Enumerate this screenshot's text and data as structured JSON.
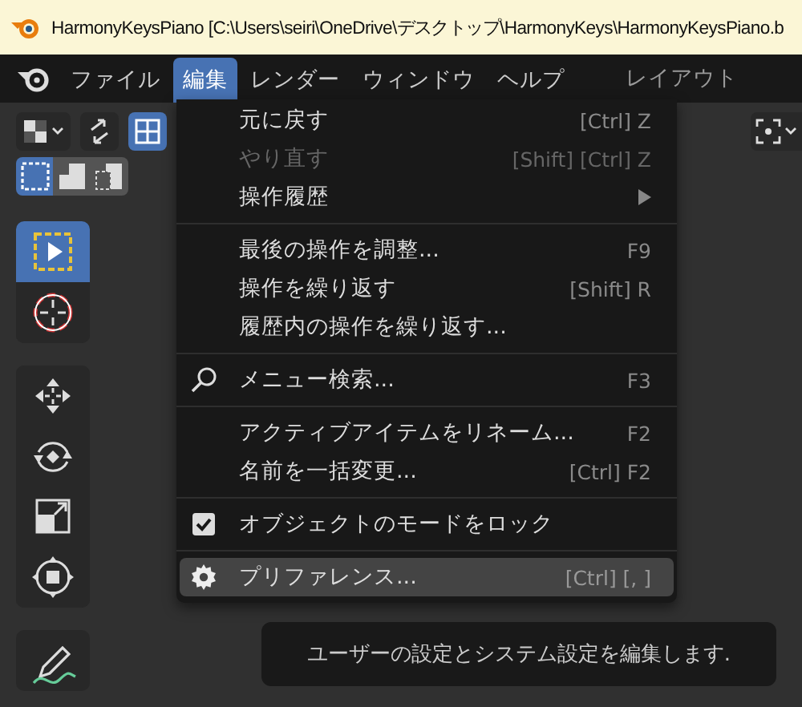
{
  "window": {
    "title": "HarmonyKeysPiano [C:\\Users\\seiri\\OneDrive\\デスクトップ\\HarmonyKeys\\HarmonyKeysPiano.b"
  },
  "menubar": {
    "items": [
      {
        "label": "ファイル",
        "selected": false
      },
      {
        "label": "編集",
        "selected": true
      },
      {
        "label": "レンダー",
        "selected": false
      },
      {
        "label": "ウィンドウ",
        "selected": false
      },
      {
        "label": "ヘルプ",
        "selected": false
      }
    ],
    "workspace_tab": "レイアウト"
  },
  "header": {
    "select_modes": [
      {
        "kind": "new",
        "selected": true
      },
      {
        "kind": "extend",
        "selected": false
      },
      {
        "kind": "subtract",
        "selected": false
      }
    ]
  },
  "toolbar": {
    "groups": [
      [
        {
          "kind": "select-box",
          "selected": true
        },
        {
          "kind": "cursor",
          "selected": false
        }
      ],
      [
        {
          "kind": "move",
          "selected": false
        },
        {
          "kind": "rotate",
          "selected": false
        },
        {
          "kind": "scale",
          "selected": false
        },
        {
          "kind": "transform",
          "selected": false
        }
      ],
      [
        {
          "kind": "annotate",
          "selected": false
        }
      ]
    ]
  },
  "menu": {
    "sections": [
      [
        {
          "kind": "plain",
          "label": "元に戻す",
          "shortcut": "[Ctrl] Z",
          "disabled": false,
          "highlighted": false
        },
        {
          "kind": "plain",
          "label": "やり直す",
          "shortcut": "[Shift] [Ctrl] Z",
          "disabled": true,
          "highlighted": false
        },
        {
          "kind": "submenu",
          "label": "操作履歴",
          "disabled": false,
          "highlighted": false
        }
      ],
      [
        {
          "kind": "plain",
          "label": "最後の操作を調整...",
          "shortcut": "F9",
          "disabled": false,
          "highlighted": false
        },
        {
          "kind": "plain",
          "label": "操作を繰り返す",
          "shortcut": "[Shift] R",
          "disabled": false,
          "highlighted": false
        },
        {
          "kind": "plain",
          "label": "履歴内の操作を繰り返す...",
          "disabled": false,
          "highlighted": false
        }
      ],
      [
        {
          "kind": "search",
          "label": "メニュー検索...",
          "shortcut": "F3",
          "disabled": false,
          "highlighted": false
        }
      ],
      [
        {
          "kind": "plain",
          "label": "アクティブアイテムをリネーム...",
          "shortcut": "F2",
          "disabled": false,
          "highlighted": false
        },
        {
          "kind": "plain",
          "label": "名前を一括変更...",
          "shortcut": "[Ctrl] F2",
          "disabled": false,
          "highlighted": false
        }
      ],
      [
        {
          "kind": "checkbox",
          "label": "オブジェクトのモードをロック",
          "checked": true,
          "disabled": false,
          "highlighted": false
        }
      ],
      [
        {
          "kind": "gear",
          "label": "プリファレンス...",
          "shortcut": "[Ctrl] [, ]",
          "disabled": false,
          "highlighted": true
        }
      ]
    ]
  },
  "tooltip": {
    "text": "ユーザーの設定とシステム設定を編集します."
  }
}
